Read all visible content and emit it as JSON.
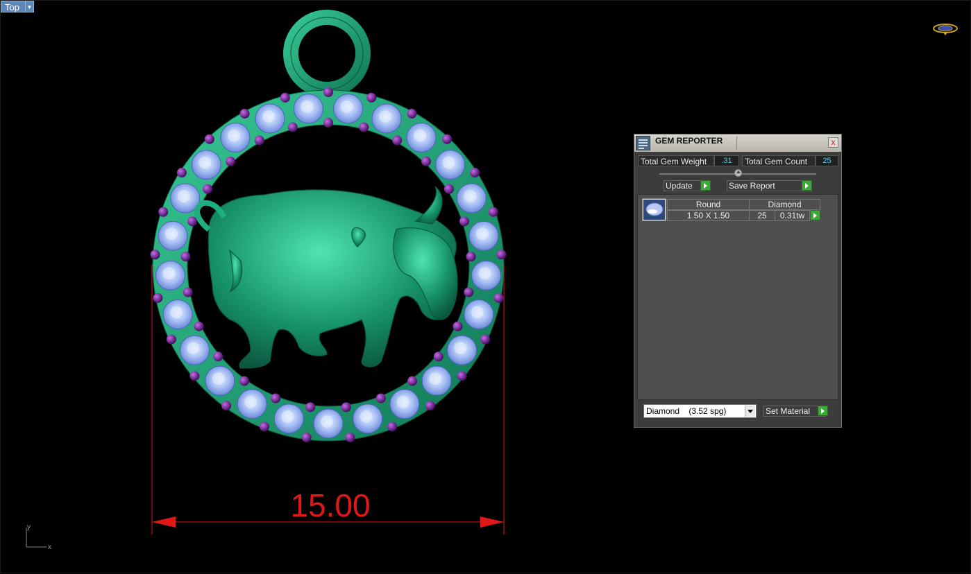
{
  "viewport": {
    "name": "Top",
    "dimension_value": "15.00",
    "axis_y": "y",
    "axis_x": "x"
  },
  "gem_reporter": {
    "title": "GEM REPORTER",
    "close_label": "x",
    "total_gem_weight_label": "Total Gem Weight",
    "total_gem_weight_value": ".31",
    "total_gem_count_label": "Total Gem Count",
    "total_gem_count_value": "25",
    "update_label": "Update",
    "save_report_label": "Save Report",
    "gem_row": {
      "shape": "Round",
      "material": "Diamond",
      "size": "1.50 X 1.50",
      "count": "25",
      "weight": "0.31tw"
    },
    "material_select_value": "Diamond    (3.52 spg)",
    "set_material_label": "Set Material"
  },
  "colors": {
    "metal": "#1f9e74",
    "gem": "#9fb8f0",
    "prong": "#6a1a8c",
    "dimension": "#e01818",
    "accent_button": "#3fa83a"
  }
}
